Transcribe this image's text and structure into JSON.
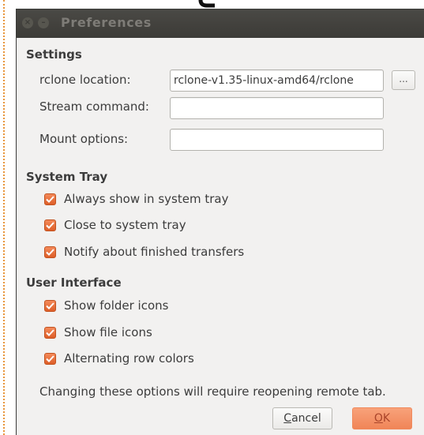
{
  "window": {
    "title": "Preferences"
  },
  "settings": {
    "header": "Settings",
    "rclone_location": {
      "label": "rclone location:",
      "value": "rclone-v1.35-linux-amd64/rclone",
      "browse_label": "..."
    },
    "stream_command": {
      "label": "Stream command:",
      "value": ""
    },
    "mount_options": {
      "label": "Mount options:",
      "value": ""
    }
  },
  "system_tray": {
    "header": "System Tray",
    "options": [
      {
        "label": "Always show in system tray",
        "checked": true
      },
      {
        "label": "Close to system tray",
        "checked": true
      },
      {
        "label": "Notify about finished transfers",
        "checked": true
      }
    ]
  },
  "user_interface": {
    "header": "User Interface",
    "options": [
      {
        "label": "Show folder icons",
        "checked": true
      },
      {
        "label": "Show file icons",
        "checked": true
      },
      {
        "label": "Alternating row colors",
        "checked": true
      }
    ],
    "note": "Changing these options will require reopening remote tab."
  },
  "buttons": {
    "cancel_mnemonic": "C",
    "cancel_rest": "ancel",
    "ok_mnemonic": "O",
    "ok_rest": "K"
  },
  "colors": {
    "accent": "#f0845a",
    "titlebar": "#3c3b37",
    "window_bg": "#f2f1f0"
  },
  "icons": {
    "close": "close-icon",
    "minimize": "minimize-icon",
    "check": "check-icon"
  }
}
